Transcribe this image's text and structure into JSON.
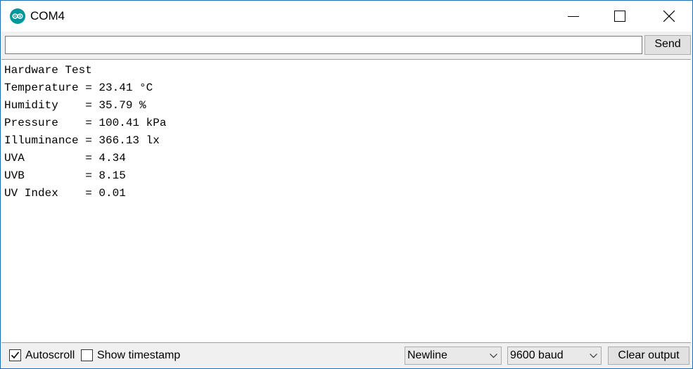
{
  "window": {
    "title": "COM4"
  },
  "send_bar": {
    "input_value": "",
    "send_label": "Send"
  },
  "output": {
    "lines": [
      "Hardware Test",
      "Temperature = 23.41 °C",
      "Humidity    = 35.79 %",
      "Pressure    = 100.41 kPa",
      "Illuminance = 366.13 lx",
      "UVA         = 4.34",
      "UVB         = 8.15",
      "UV Index    = 0.01"
    ]
  },
  "bottom_bar": {
    "autoscroll_label": "Autoscroll",
    "autoscroll_checked": true,
    "timestamp_label": "Show timestamp",
    "timestamp_checked": false,
    "line_ending": "Newline",
    "baud_rate": "9600 baud",
    "clear_label": "Clear output"
  },
  "colors": {
    "app_icon": "#00979c",
    "window_border": "#1f6fb5"
  }
}
